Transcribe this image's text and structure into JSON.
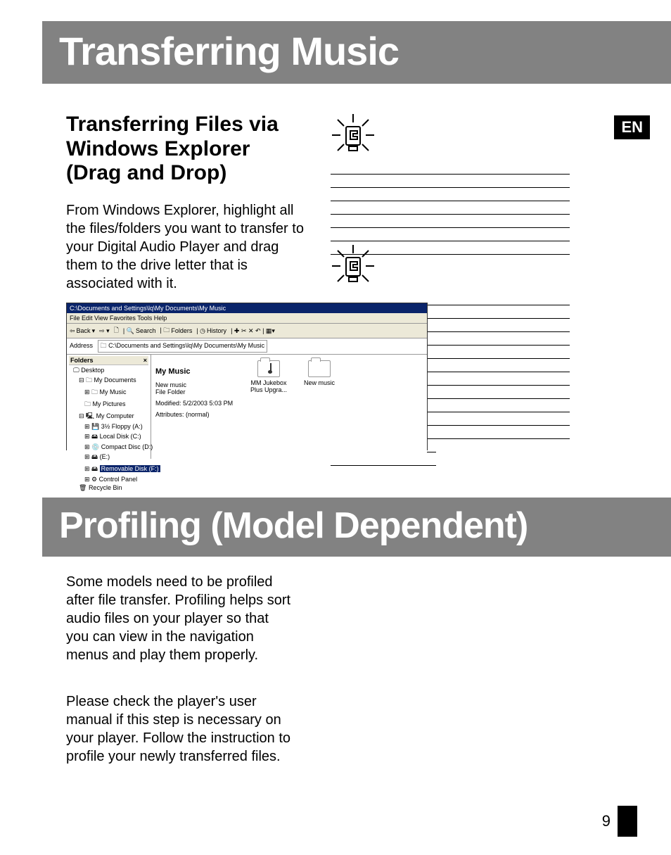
{
  "lang_badge": "EN",
  "banner1": "Transferring Music",
  "banner2": "Profiling (Model Dependent)",
  "section_heading": "Transferring Files via Windows Explorer (Drag and Drop)",
  "para1": "From Windows Explorer, highlight all the files/folders you want to transfer to your Digital Audio Player and drag them to the drive letter that is associated with it.",
  "para2": "Some models need to be profiled after file transfer. Profiling helps sort audio files on your player so that you can view in the navigation menus and play them properly.",
  "para3": "Please check the player's user manual if this step is necessary on your player. Follow the instruction to profile your newly transferred files.",
  "page_number": "9",
  "explorer": {
    "titlebar": "C:\\Documents and Settings\\lq\\My Documents\\My Music",
    "menubar": "File   Edit   View   Favorites   Tools   Help",
    "toolbar": {
      "back": "Back",
      "search": "Search",
      "folders": "Folders",
      "history": "History"
    },
    "address_label": "Address",
    "address_value": "C:\\Documents and Settings\\lq\\My Documents\\My Music",
    "folders_header": "Folders",
    "tree": {
      "desktop": "Desktop",
      "my_documents": "My Documents",
      "my_music": "My Music",
      "my_pictures": "My Pictures",
      "my_computer": "My Computer",
      "floppy": "3½ Floppy (A:)",
      "local": "Local Disk (C:)",
      "compact": "Compact Disc (D:)",
      "e": "(E:)",
      "removable": "Removable Disk (F:)",
      "control": "Control Panel",
      "recycle": "Recycle Bin"
    },
    "info": {
      "title": "My Music",
      "line1": "New music",
      "line2": "File Folder",
      "line3": "Modified: 5/2/2003 5:03 PM",
      "line4": "Attributes: (normal)"
    },
    "icons": {
      "item1": "MM Jukebox Plus Upgra...",
      "item2": "New music"
    }
  }
}
